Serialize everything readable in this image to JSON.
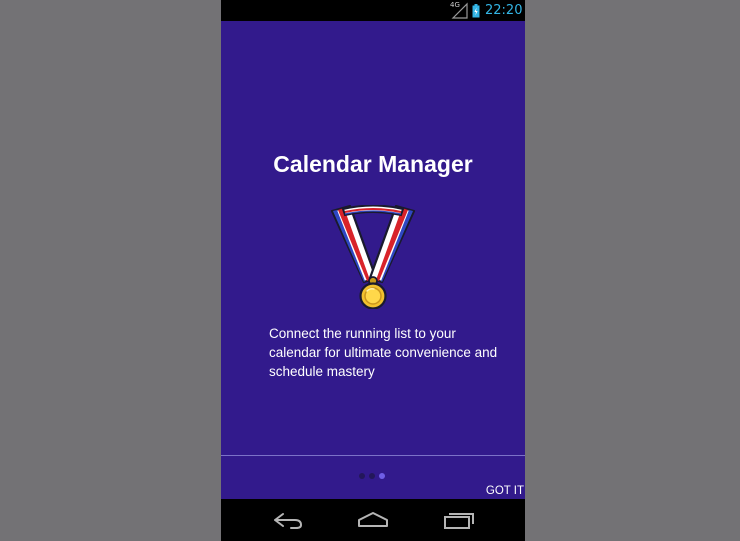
{
  "status_bar": {
    "network_label": "4G",
    "time": "22:20"
  },
  "onboarding": {
    "title": "Calendar Manager",
    "description": "Connect the running list to your calendar for ultimate convenience and schedule mastery",
    "illustration": "gold-medal-icon",
    "pager": {
      "count": 3,
      "active_index": 2
    },
    "got_it_label": "GOT IT"
  },
  "navigation": {
    "back": "back-icon",
    "home": "home-icon",
    "recents": "recents-icon"
  },
  "colors": {
    "screen_background": "#321a8c",
    "clock": "#33b5e5",
    "active_dot": "#6f5ee6"
  }
}
